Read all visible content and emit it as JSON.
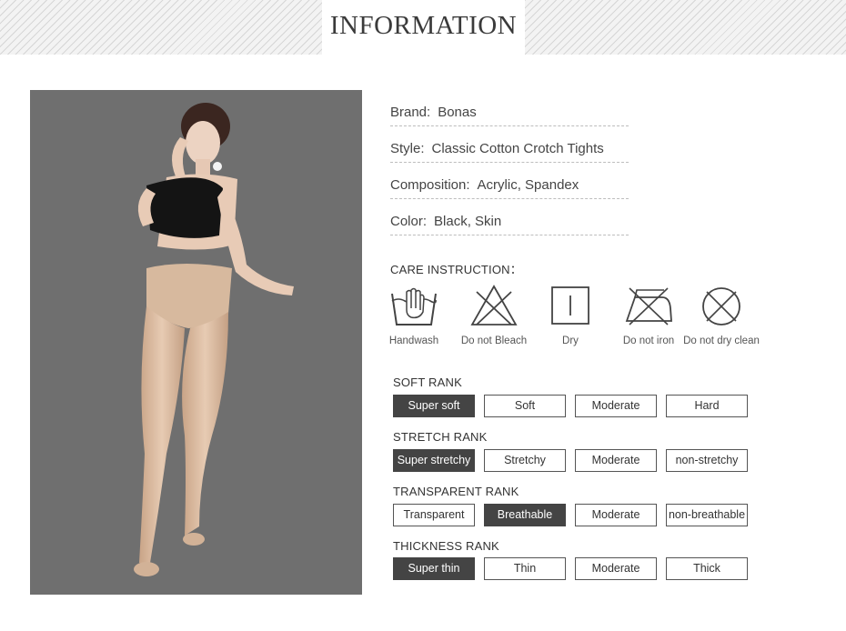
{
  "header": {
    "title": "INFORMATION"
  },
  "info": [
    {
      "label": "Brand:",
      "value": "Bonas"
    },
    {
      "label": "Style:",
      "value": "Classic Cotton Crotch Tights"
    },
    {
      "label": "Composition:",
      "value": "Acrylic, Spandex"
    },
    {
      "label": "Color:",
      "value": "Black, Skin"
    }
  ],
  "care": {
    "title": "CARE INSTRUCTION：",
    "items": [
      {
        "icon": "handwash-icon",
        "label": "Handwash"
      },
      {
        "icon": "do-not-bleach-icon",
        "label": "Do not Bleach"
      },
      {
        "icon": "dry-icon",
        "label": "Dry"
      },
      {
        "icon": "do-not-iron-icon",
        "label": "Do not iron"
      },
      {
        "icon": "do-not-dry-clean-icon",
        "label": "Do not dry clean"
      }
    ]
  },
  "ranks": [
    {
      "title": "SOFT RANK",
      "options": [
        "Super soft",
        "Soft",
        "Moderate",
        "Hard"
      ],
      "selected": 0
    },
    {
      "title": "STRETCH RANK",
      "options": [
        "Super stretchy",
        "Stretchy",
        "Moderate",
        "non-stretchy"
      ],
      "selected": 0
    },
    {
      "title": "TRANSPARENT RANK",
      "options": [
        "Transparent",
        "Breathable",
        "Moderate",
        "non-breathable"
      ],
      "selected": 1
    },
    {
      "title": "THICKNESS RANK",
      "options": [
        "Super thin",
        "Thin",
        "Moderate",
        "Thick"
      ],
      "selected": 0
    }
  ],
  "colors": {
    "photo_bg": "#6f6f6f",
    "selected_bg": "#444444",
    "skin": "#e4c2a6"
  }
}
